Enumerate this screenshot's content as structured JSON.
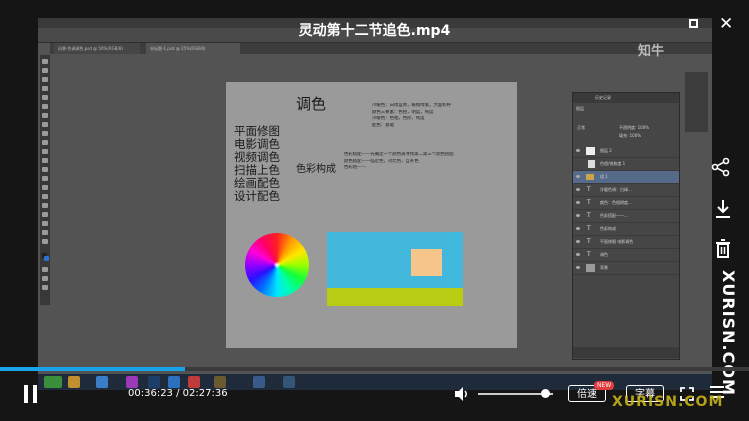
{
  "player": {
    "title": "灵动第十二节追色.mp4",
    "current_time": "00:36:23",
    "total_time": "02:27:36",
    "time_separator": " / ",
    "progress_fraction": 0.247,
    "volume_fraction": 0.9,
    "speed_label": "倍速",
    "new_badge": "NEW",
    "subtitle_label": "字幕",
    "side_watermark": "XURISN.COM",
    "bottom_watermark": "XURISN.COM"
  },
  "photoshop": {
    "tabs": [
      "风景-色调调色.psd @ 50%(RGB/8)",
      "未标题-1.psd @ 25%(RGB/8)"
    ],
    "watermark": "知牛",
    "canvas": {
      "title": "调色",
      "uses": [
        "平面修图",
        "电影调色",
        "视频调色",
        "扫描上色",
        "绘画配色",
        "设计配色"
      ],
      "composition": "色彩构成",
      "notes_top": [
        "冷暖色：白绿蓝青，暖橙绿紫，大面积呼",
        "颜色三要素：色相，明度，纯度",
        "冷暖色：色相，色阶，纯度",
        "配色：基础"
      ],
      "notes_mid": [
        "色彩搭配——先确定一个颜色再寻找第二第三个颜色搭配",
        "颜色搭配——临近色，对比色，互补色",
        "色彩组——"
      ]
    },
    "layers_panel": {
      "header": "历史记录",
      "tab": "图层",
      "blend_mode": "正常",
      "opacity_label": "不透明度: 100%",
      "fill_label": "填充: 100%",
      "layers": [
        {
          "name": "图层 2",
          "kind": "image"
        },
        {
          "name": "色相/饱和度 1",
          "kind": "adjust"
        },
        {
          "name": "组 1",
          "kind": "group"
        },
        {
          "name": "冷暖色调：白绿...",
          "kind": "text"
        },
        {
          "name": "颜色：色相明度...",
          "kind": "text"
        },
        {
          "name": "色彩搭配——...",
          "kind": "text"
        },
        {
          "name": "色彩构成",
          "kind": "text"
        },
        {
          "name": "平面修图 电影调色",
          "kind": "text"
        },
        {
          "name": "调色",
          "kind": "text"
        },
        {
          "name": "背景",
          "kind": "image"
        }
      ]
    }
  },
  "colors": {
    "progress": "#1aa3e8",
    "canvas": "#9a9a9a",
    "sky": "#41b8dc",
    "grass": "#b9cc14",
    "sun": "#f6c58a",
    "badge": "#e23b3b"
  }
}
